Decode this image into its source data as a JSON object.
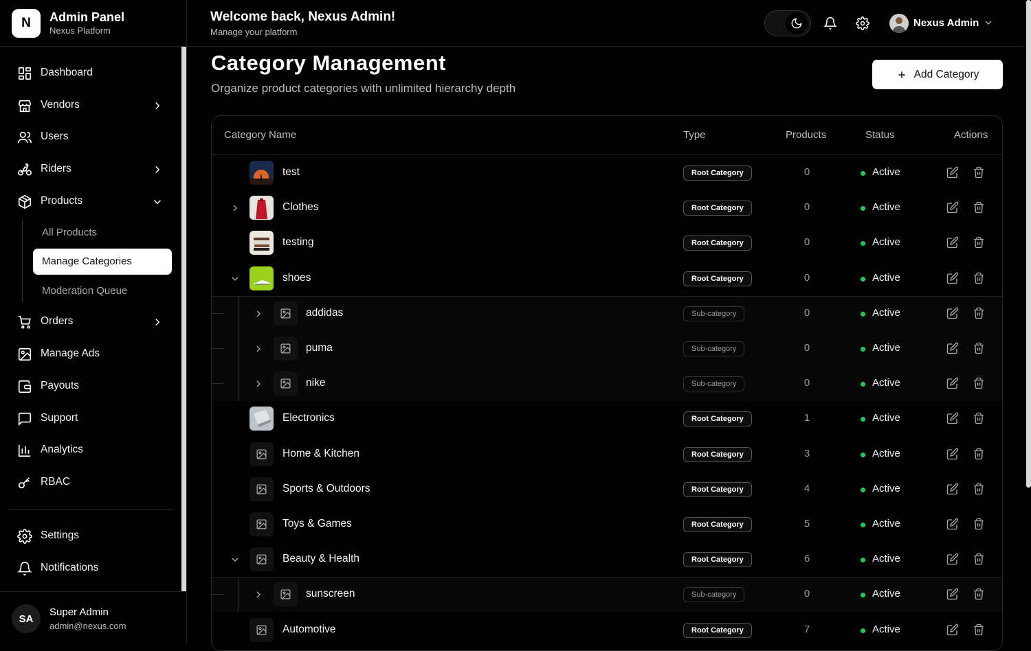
{
  "brand": {
    "logo_letter": "N",
    "title": "Admin Panel",
    "subtitle": "Nexus Platform"
  },
  "sidebar": {
    "items": [
      {
        "label": "Dashboard",
        "icon": "dashboard-icon"
      },
      {
        "label": "Vendors",
        "icon": "store-icon",
        "has_chevron": true
      },
      {
        "label": "Users",
        "icon": "users-icon"
      },
      {
        "label": "Riders",
        "icon": "bike-icon",
        "has_chevron": true
      },
      {
        "label": "Products",
        "icon": "package-icon",
        "expanded": true
      },
      {
        "label": "Orders",
        "icon": "cart-icon",
        "has_chevron": true
      },
      {
        "label": "Manage Ads",
        "icon": "image-icon"
      },
      {
        "label": "Payouts",
        "icon": "wallet-icon"
      },
      {
        "label": "Support",
        "icon": "message-icon"
      },
      {
        "label": "Analytics",
        "icon": "bar-chart-icon"
      },
      {
        "label": "RBAC",
        "icon": "key-icon"
      },
      {
        "label": "Settings",
        "icon": "gear-icon"
      },
      {
        "label": "Notifications",
        "icon": "bell-icon"
      }
    ],
    "product_subitems": [
      {
        "label": "All Products"
      },
      {
        "label": "Manage Categories",
        "active": true
      },
      {
        "label": "Moderation Queue"
      }
    ],
    "user": {
      "initials": "SA",
      "name": "Super Admin",
      "email": "admin@nexus.com"
    }
  },
  "header": {
    "welcome": "Welcome back, Nexus Admin!",
    "subtitle": "Manage your platform",
    "profile_name": "Nexus Admin"
  },
  "main": {
    "title": "Category Management",
    "subtitle": "Organize product categories with unlimited hierarchy depth",
    "add_button": "Add Category"
  },
  "table": {
    "columns": [
      "Category Name",
      "Type",
      "Products",
      "Status",
      "Actions"
    ],
    "rows": [
      {
        "name": "test",
        "type": "Root Category",
        "products": "0",
        "status": "Active",
        "level": 0,
        "toggle": "none",
        "thumb": "photo-night"
      },
      {
        "name": "Clothes",
        "type": "Root Category",
        "products": "0",
        "status": "Active",
        "level": 0,
        "toggle": "collapsed",
        "thumb": "photo-red"
      },
      {
        "name": "testing",
        "type": "Root Category",
        "products": "0",
        "status": "Active",
        "level": 0,
        "toggle": "none",
        "thumb": "photo-books"
      },
      {
        "name": "shoes",
        "type": "Root Category",
        "products": "0",
        "status": "Active",
        "level": 0,
        "toggle": "expanded",
        "thumb": "photo-green"
      },
      {
        "name": "addidas",
        "type": "Sub-category",
        "products": "0",
        "status": "Active",
        "level": 1,
        "toggle": "collapsed",
        "thumb": "placeholder"
      },
      {
        "name": "puma",
        "type": "Sub-category",
        "products": "0",
        "status": "Active",
        "level": 1,
        "toggle": "collapsed",
        "thumb": "placeholder"
      },
      {
        "name": "nike",
        "type": "Sub-category",
        "products": "0",
        "status": "Active",
        "level": 1,
        "toggle": "collapsed",
        "thumb": "placeholder"
      },
      {
        "name": "Electronics",
        "type": "Root Category",
        "products": "1",
        "status": "Active",
        "level": 0,
        "toggle": "none",
        "thumb": "photo-laptop"
      },
      {
        "name": "Home & Kitchen",
        "type": "Root Category",
        "products": "3",
        "status": "Active",
        "level": 0,
        "toggle": "none",
        "thumb": "placeholder"
      },
      {
        "name": "Sports & Outdoors",
        "type": "Root Category",
        "products": "4",
        "status": "Active",
        "level": 0,
        "toggle": "none",
        "thumb": "placeholder"
      },
      {
        "name": "Toys & Games",
        "type": "Root Category",
        "products": "5",
        "status": "Active",
        "level": 0,
        "toggle": "none",
        "thumb": "placeholder"
      },
      {
        "name": "Beauty & Health",
        "type": "Root Category",
        "products": "6",
        "status": "Active",
        "level": 0,
        "toggle": "expanded",
        "thumb": "placeholder"
      },
      {
        "name": "sunscreen",
        "type": "Sub-category",
        "products": "0",
        "status": "Active",
        "level": 1,
        "toggle": "collapsed",
        "thumb": "placeholder"
      },
      {
        "name": "Automotive",
        "type": "Root Category",
        "products": "7",
        "status": "Active",
        "level": 0,
        "toggle": "none",
        "thumb": "placeholder"
      }
    ]
  },
  "colors": {
    "active_dot": "#22c55e",
    "background": "#000000",
    "accent": "#ffffff"
  }
}
